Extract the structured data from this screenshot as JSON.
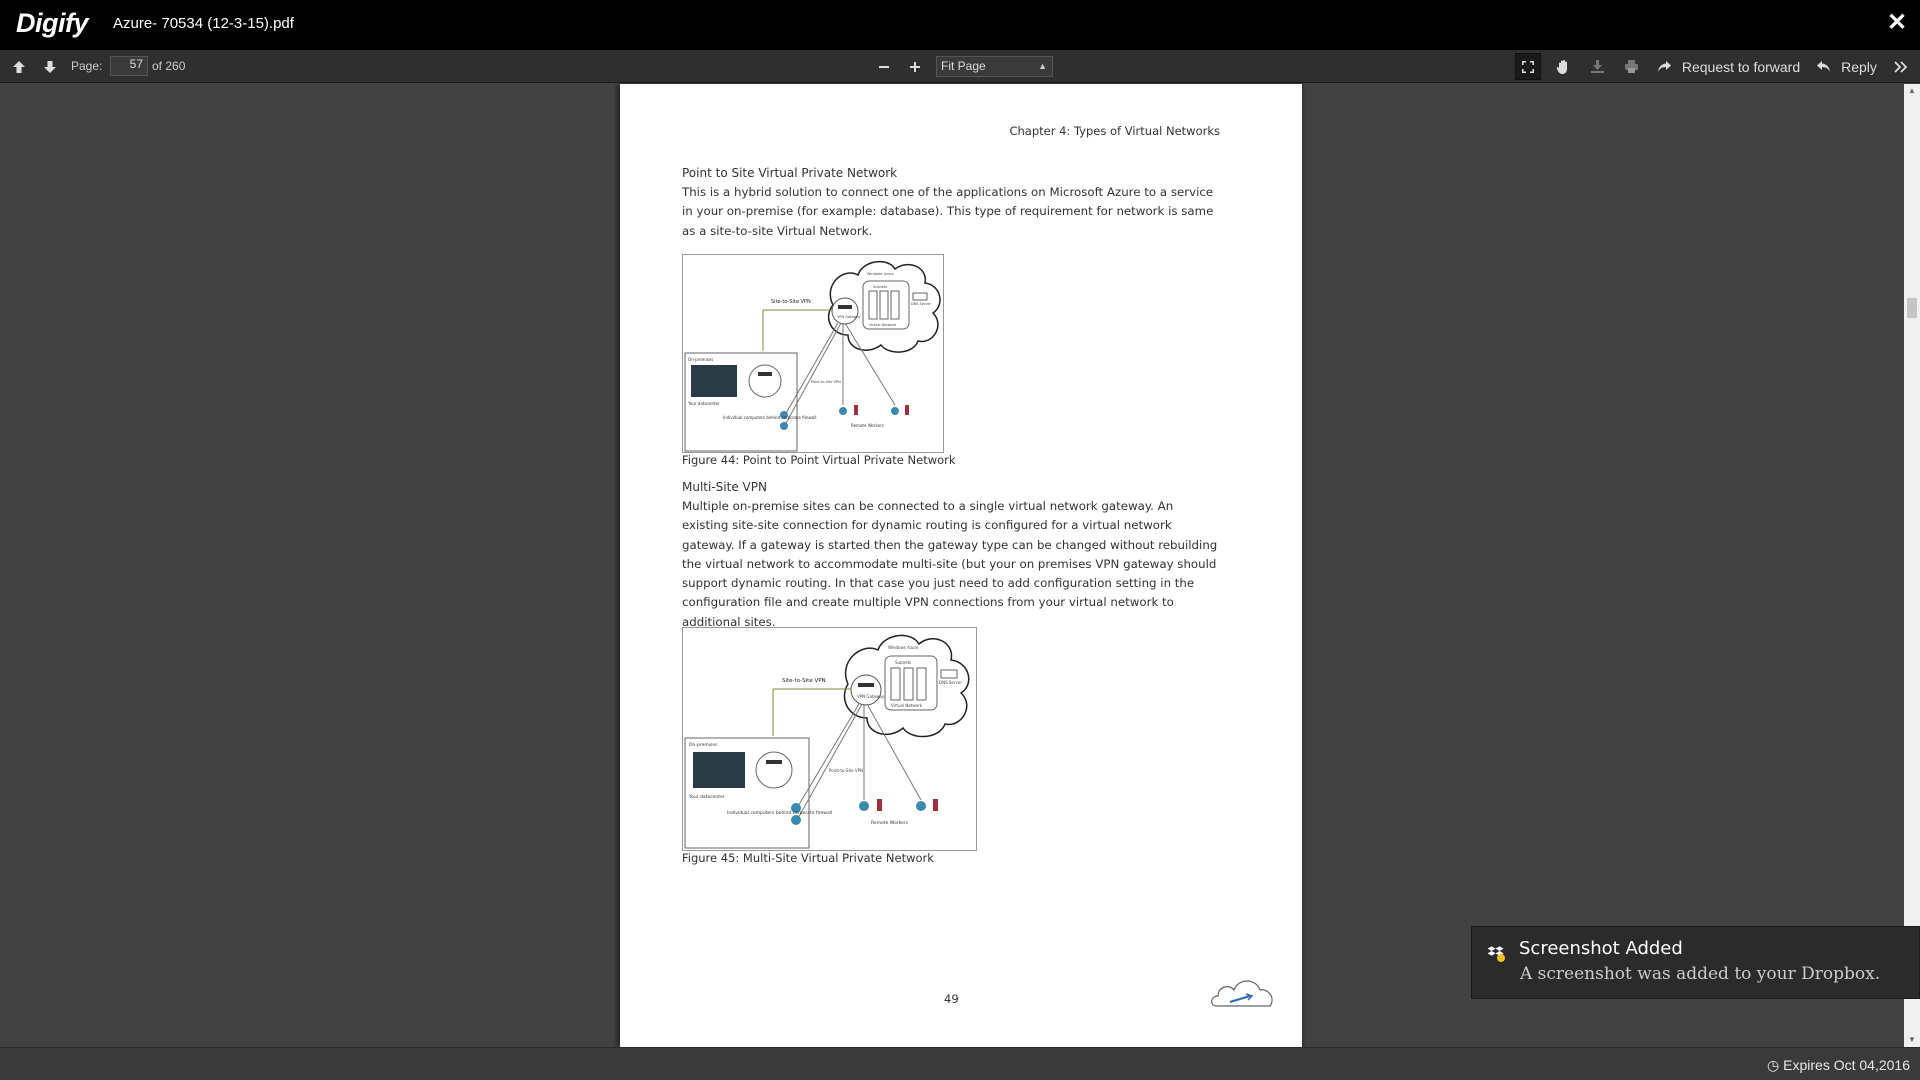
{
  "app": {
    "logo": "Digify",
    "filename": "Azure- 70534 (12-3-15).pdf",
    "close_icon": "close-icon"
  },
  "toolbar": {
    "prev_page_icon": "arrow-up-icon",
    "next_page_icon": "arrow-down-icon",
    "page_label": "Page:",
    "page_value": "57",
    "page_total": "of 260",
    "zoom_out_icon": "minus-icon",
    "zoom_in_icon": "plus-icon",
    "zoom_value": "Fit Page",
    "fullscreen_icon": "fullscreen-icon",
    "hand_tool_icon": "hand-icon",
    "download_icon": "download-icon",
    "print_icon": "print-icon",
    "forward_label": "Request to forward",
    "reply_label": "Reply",
    "more_icon": "double-chevron-right-icon"
  },
  "document": {
    "chapter_header": "Chapter 4: Types of Virtual Networks",
    "section1_title": "Point to Site Virtual Private Network",
    "section1_text": "This is a hybrid solution to connect one of the applications on Microsoft Azure to a service in your on-premise (for example: database). This type of requirement for network is same as a site-to-site Virtual Network.",
    "figure44_caption": "Figure 44: Point to Point Virtual Private Network",
    "section2_title": "Multi-Site VPN",
    "section2_text": "Multiple on-premise sites can be connected to a single virtual network gateway. An existing site-site connection for dynamic routing is configured for a virtual network gateway. If a gateway is started then the gateway type can be changed without rebuilding the virtual network to accommodate multi-site (but your on premises VPN gateway should support dynamic routing. In that case you just need to add configuration setting in the configuration file and create multiple VPN connections from your virtual network to additional sites.",
    "figure45_caption": "Figure 45: Multi-Site Virtual Private Network",
    "page_number": "49",
    "diagram": {
      "site_to_site": "Site-to-Site VPN",
      "windows_azure": "Windows Azure",
      "subnets": "Subnets",
      "vpn_gateway": "VPN Gateway",
      "virtual_network": "Virtual Network",
      "dns_server": "DNS Server",
      "on_premises": "On-premises",
      "hardware_vpn": "Hardware VPN or Windows RRAS",
      "your_datacenter": "Your datacenter",
      "point_to_site": "Point-to-Site VPN",
      "individual_computers": "Individual computers behind corporate firewall",
      "remote_workers": "Remote Workers"
    }
  },
  "status": {
    "expires": "Expires Oct 04,2016",
    "clock_icon": "clock-icon"
  },
  "toast": {
    "icon": "dropbox-icon",
    "title": "Screenshot Added",
    "body": "A screenshot was added to your Dropbox."
  }
}
